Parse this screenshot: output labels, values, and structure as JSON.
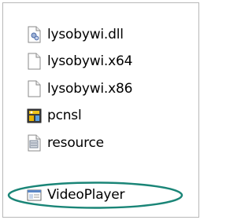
{
  "files": [
    {
      "name": "lysobywi.dll",
      "icon": "dll-file-icon"
    },
    {
      "name": "lysobywi.x64",
      "icon": "blank-file-icon"
    },
    {
      "name": "lysobywi.x86",
      "icon": "blank-file-icon"
    },
    {
      "name": "pcnsl",
      "icon": "app-icon"
    },
    {
      "name": "resource",
      "icon": "text-file-icon"
    },
    {
      "name": "VideoPlayer",
      "icon": "window-app-icon"
    }
  ],
  "highlight_color": "#1a8577"
}
